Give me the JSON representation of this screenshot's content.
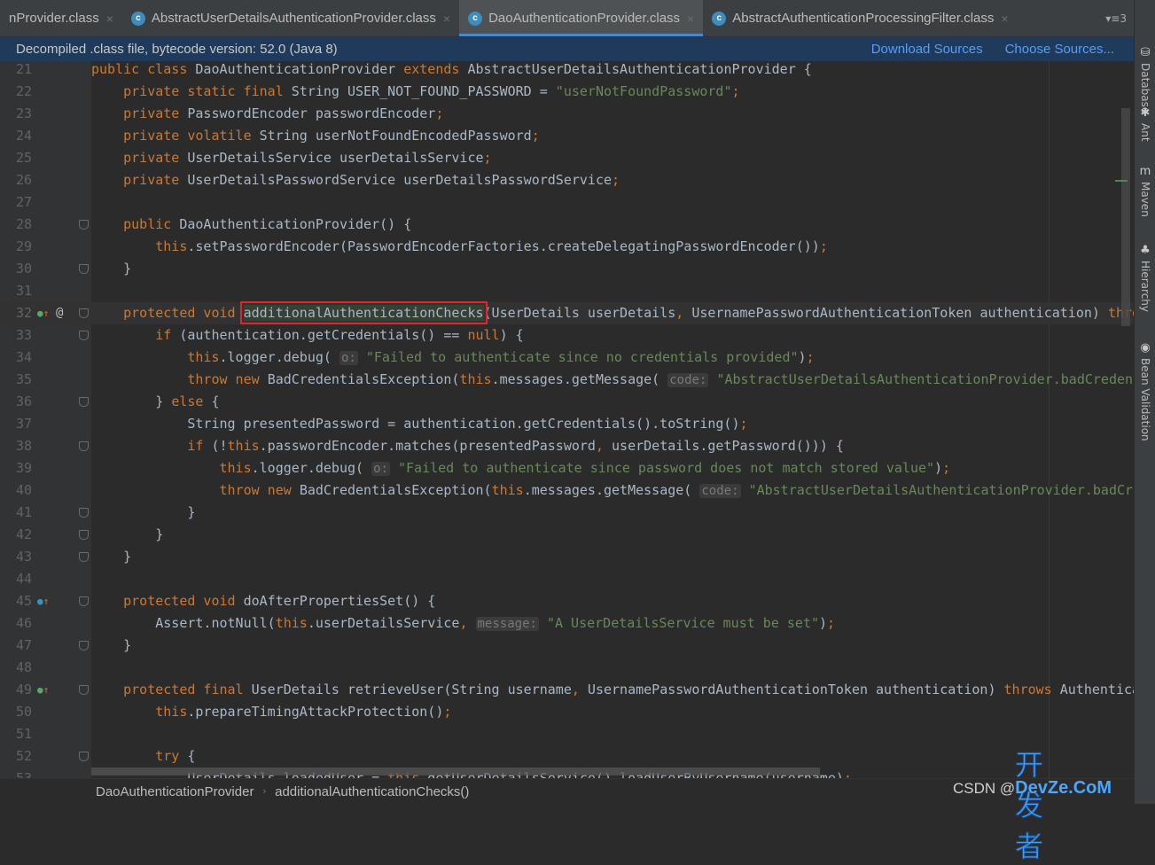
{
  "tabs": [
    {
      "label": "nProvider.class",
      "active": false,
      "icon": "class-icon"
    },
    {
      "label": "AbstractUserDetailsAuthenticationProvider.class",
      "active": false,
      "icon": "class-icon"
    },
    {
      "label": "DaoAuthenticationProvider.class",
      "active": true,
      "icon": "class-icon"
    },
    {
      "label": "AbstractAuthenticationProcessingFilter.class",
      "active": false,
      "icon": "class-icon"
    }
  ],
  "tab_overflow": "▾≡3",
  "infobar": {
    "text": "Decompiled .class file, bytecode version: 52.0 (Java 8)",
    "download": "Download Sources",
    "choose": "Choose Sources..."
  },
  "sidebar": [
    {
      "label": "Database",
      "icon": "database-icon"
    },
    {
      "label": "Ant",
      "icon": "ant-icon"
    },
    {
      "label": "Maven",
      "icon": "maven-icon"
    },
    {
      "label": "Hierarchy",
      "icon": "hierarchy-icon"
    },
    {
      "label": "Bean Validation",
      "icon": "bean-validation-icon"
    }
  ],
  "breadcrumb": [
    "DaoAuthenticationProvider",
    "additionalAuthenticationChecks()"
  ],
  "watermark": {
    "cn": "开发者",
    "csdn": "CSDN @",
    "site": "DevZe.CoM"
  },
  "colors": {
    "keyword": "#cc7832",
    "string": "#6a8759",
    "text": "#a9b7c6",
    "highlight_box": "#e0262a",
    "link": "#589df6"
  },
  "code": [
    {
      "n": 21,
      "segs": [
        [
          "k",
          "public class "
        ],
        [
          "p",
          "DaoAuthenticationProvider "
        ],
        [
          "k",
          "extends "
        ],
        [
          "p",
          "AbstractUserDetailsAuthenticationProvider {"
        ]
      ]
    },
    {
      "n": 22,
      "segs": [
        [
          "p",
          "    "
        ],
        [
          "k",
          "private static final "
        ],
        [
          "p",
          "String USER_NOT_FOUND_PASSWORD = "
        ],
        [
          "s",
          "\"userNotFoundPassword\""
        ],
        [
          "k",
          ";"
        ]
      ]
    },
    {
      "n": 23,
      "segs": [
        [
          "p",
          "    "
        ],
        [
          "k",
          "private "
        ],
        [
          "p",
          "PasswordEncoder passwordEncoder"
        ],
        [
          "k",
          ";"
        ]
      ]
    },
    {
      "n": 24,
      "segs": [
        [
          "p",
          "    "
        ],
        [
          "k",
          "private volatile "
        ],
        [
          "p",
          "String userNotFoundEncodedPassword"
        ],
        [
          "k",
          ";"
        ]
      ]
    },
    {
      "n": 25,
      "segs": [
        [
          "p",
          "    "
        ],
        [
          "k",
          "private "
        ],
        [
          "p",
          "UserDetailsService userDetailsService"
        ],
        [
          "k",
          ";"
        ]
      ]
    },
    {
      "n": 26,
      "segs": [
        [
          "p",
          "    "
        ],
        [
          "k",
          "private "
        ],
        [
          "p",
          "UserDetailsPasswordService userDetailsPasswordService"
        ],
        [
          "k",
          ";"
        ]
      ]
    },
    {
      "n": 27,
      "segs": []
    },
    {
      "n": 28,
      "fold": true,
      "segs": [
        [
          "p",
          "    "
        ],
        [
          "k",
          "public "
        ],
        [
          "p",
          "DaoAuthenticationProvider() {"
        ]
      ]
    },
    {
      "n": 29,
      "segs": [
        [
          "p",
          "        "
        ],
        [
          "k",
          "this"
        ],
        [
          "p",
          ".setPasswordEncoder(PasswordEncoderFactories.createDelegatingPasswordEncoder())"
        ],
        [
          "k",
          ";"
        ]
      ]
    },
    {
      "n": 30,
      "fold": true,
      "segs": [
        [
          "p",
          "    }"
        ]
      ]
    },
    {
      "n": 31,
      "segs": []
    },
    {
      "n": 32,
      "fold": true,
      "cur": true,
      "gutter": "override-icon",
      "at": "@",
      "segs": [
        [
          "p",
          "    "
        ],
        [
          "k",
          "protected void "
        ],
        [
          "box",
          "additionalAuthenticationChecks"
        ],
        [
          "p",
          "(UserDetails userDetails"
        ],
        [
          "k",
          ", "
        ],
        [
          "p",
          "UsernamePasswordAuthenticationToken authentication) "
        ],
        [
          "k",
          "thro"
        ]
      ]
    },
    {
      "n": 33,
      "fold": true,
      "segs": [
        [
          "p",
          "        "
        ],
        [
          "k",
          "if "
        ],
        [
          "p",
          "(authentication.getCredentials() == "
        ],
        [
          "k",
          "null"
        ],
        [
          "p",
          ") {"
        ]
      ]
    },
    {
      "n": 34,
      "segs": [
        [
          "p",
          "            "
        ],
        [
          "k",
          "this"
        ],
        [
          "p",
          ".logger.debug( "
        ],
        [
          "h",
          "o:"
        ],
        [
          "p",
          " "
        ],
        [
          "s",
          "\"Failed to authenticate since no credentials provided\""
        ],
        [
          "p",
          ")"
        ],
        [
          "k",
          ";"
        ]
      ]
    },
    {
      "n": 35,
      "segs": [
        [
          "p",
          "            "
        ],
        [
          "k",
          "throw new "
        ],
        [
          "p",
          "BadCredentialsException("
        ],
        [
          "k",
          "this"
        ],
        [
          "p",
          ".messages.getMessage( "
        ],
        [
          "h",
          "code:"
        ],
        [
          "p",
          " "
        ],
        [
          "s",
          "\"AbstractUserDetailsAuthenticationProvider.badCredent"
        ]
      ]
    },
    {
      "n": 36,
      "fold": true,
      "segs": [
        [
          "p",
          "        } "
        ],
        [
          "k",
          "else "
        ],
        [
          "p",
          "{"
        ]
      ]
    },
    {
      "n": 37,
      "segs": [
        [
          "p",
          "            String presentedPassword = authentication.getCredentials().toString()"
        ],
        [
          "k",
          ";"
        ]
      ]
    },
    {
      "n": 38,
      "fold": true,
      "segs": [
        [
          "p",
          "            "
        ],
        [
          "k",
          "if "
        ],
        [
          "p",
          "(!"
        ],
        [
          "k",
          "this"
        ],
        [
          "p",
          ".passwordEncoder.matches(presentedPassword"
        ],
        [
          "k",
          ", "
        ],
        [
          "p",
          "userDetails.getPassword())) {"
        ]
      ]
    },
    {
      "n": 39,
      "segs": [
        [
          "p",
          "                "
        ],
        [
          "k",
          "this"
        ],
        [
          "p",
          ".logger.debug( "
        ],
        [
          "h",
          "o:"
        ],
        [
          "p",
          " "
        ],
        [
          "s",
          "\"Failed to authenticate since password does not match stored value\""
        ],
        [
          "p",
          ")"
        ],
        [
          "k",
          ";"
        ]
      ]
    },
    {
      "n": 40,
      "segs": [
        [
          "p",
          "                "
        ],
        [
          "k",
          "throw new "
        ],
        [
          "p",
          "BadCredentialsException("
        ],
        [
          "k",
          "this"
        ],
        [
          "p",
          ".messages.getMessage( "
        ],
        [
          "h",
          "code:"
        ],
        [
          "p",
          " "
        ],
        [
          "s",
          "\"AbstractUserDetailsAuthenticationProvider.badCre"
        ]
      ]
    },
    {
      "n": 41,
      "fold": true,
      "segs": [
        [
          "p",
          "            }"
        ]
      ]
    },
    {
      "n": 42,
      "fold": true,
      "segs": [
        [
          "p",
          "        }"
        ]
      ]
    },
    {
      "n": 43,
      "fold": true,
      "segs": [
        [
          "p",
          "    }"
        ]
      ]
    },
    {
      "n": 44,
      "segs": []
    },
    {
      "n": 45,
      "fold": true,
      "gutter": "implements-icon",
      "segs": [
        [
          "p",
          "    "
        ],
        [
          "k",
          "protected void "
        ],
        [
          "p",
          "doAfterPropertiesSet() {"
        ]
      ]
    },
    {
      "n": 46,
      "segs": [
        [
          "p",
          "        Assert.notNull("
        ],
        [
          "k",
          "this"
        ],
        [
          "p",
          ".userDetailsService"
        ],
        [
          "k",
          ", "
        ],
        [
          "h",
          "message:"
        ],
        [
          "p",
          " "
        ],
        [
          "s",
          "\"A UserDetailsService must be set\""
        ],
        [
          "p",
          ")"
        ],
        [
          "k",
          ";"
        ]
      ]
    },
    {
      "n": 47,
      "fold": true,
      "segs": [
        [
          "p",
          "    }"
        ]
      ]
    },
    {
      "n": 48,
      "segs": []
    },
    {
      "n": 49,
      "fold": true,
      "gutter": "override-icon",
      "segs": [
        [
          "p",
          "    "
        ],
        [
          "k",
          "protected final "
        ],
        [
          "p",
          "UserDetails retrieveUser(String username"
        ],
        [
          "k",
          ", "
        ],
        [
          "p",
          "UsernamePasswordAuthenticationToken authentication) "
        ],
        [
          "k",
          "throws "
        ],
        [
          "p",
          "Authentica"
        ]
      ]
    },
    {
      "n": 50,
      "segs": [
        [
          "p",
          "        "
        ],
        [
          "k",
          "this"
        ],
        [
          "p",
          ".prepareTimingAttackProtection()"
        ],
        [
          "k",
          ";"
        ]
      ]
    },
    {
      "n": 51,
      "segs": []
    },
    {
      "n": 52,
      "fold": true,
      "segs": [
        [
          "p",
          "        "
        ],
        [
          "k",
          "try "
        ],
        [
          "p",
          "{"
        ]
      ]
    },
    {
      "n": 53,
      "segs": [
        [
          "p",
          "            UserDetails loadedUser = "
        ],
        [
          "k",
          "this"
        ],
        [
          "p",
          ".getUserDetailsService().loadUserByUsername(username)"
        ],
        [
          "k",
          ";"
        ]
      ]
    }
  ]
}
